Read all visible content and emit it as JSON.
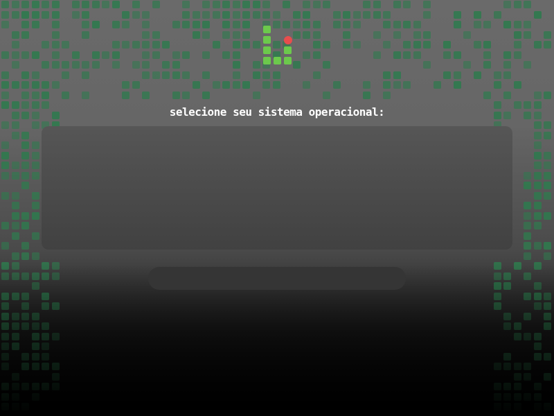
{
  "prompt": {
    "text": "selecione seu sistema operacional:"
  },
  "theme": {
    "grid_color": "#2f7a4e",
    "logo_green": "#6cc94c",
    "logo_red": "#e84d4d",
    "panel_color": "#4a4a4a"
  },
  "logo": {
    "icon": "pixel-logo-icon"
  },
  "os_panel": {
    "items": []
  },
  "action_bar": {
    "label": ""
  }
}
